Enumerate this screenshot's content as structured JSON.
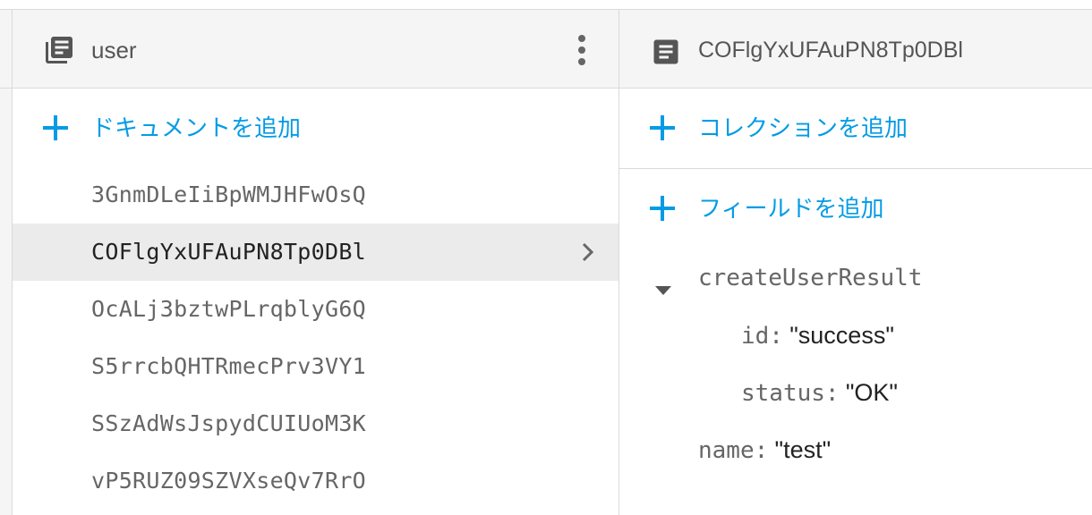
{
  "collection": {
    "title": "user",
    "add_document_label": "ドキュメントを追加",
    "documents": [
      "3GnmDLeIiBpWMJHFwOsQ",
      "COFlgYxUFAuPN8Tp0DBl",
      "OcALj3bztwPLrqblyG6Q",
      "S5rrcbQHTRmecPrv3VY1",
      "SSzAdWsJspydCUIUoM3K",
      "vP5RUZ09SZVXseQv7RrO"
    ],
    "selected_index": 1
  },
  "document": {
    "title": "COFlgYxUFAuPN8Tp0DBl",
    "add_collection_label": "コレクションを追加",
    "add_field_label": "フィールドを追加",
    "fields": {
      "map_key": "createUserResult",
      "id_key": "id:",
      "id_value": "\"success\"",
      "status_key": "status:",
      "status_value": "\"OK\"",
      "name_key": "name:",
      "name_value": "\"test\""
    }
  },
  "colors": {
    "accent": "#039be5",
    "header_bg": "#f5f5f5",
    "selected_bg": "#ebebeb"
  },
  "icons": {
    "collection": "library-books-icon",
    "document": "document-icon",
    "menu": "more-vert-icon",
    "add": "plus-icon",
    "selected": "chevron-right-icon",
    "expand": "arrow-drop-down-icon"
  }
}
